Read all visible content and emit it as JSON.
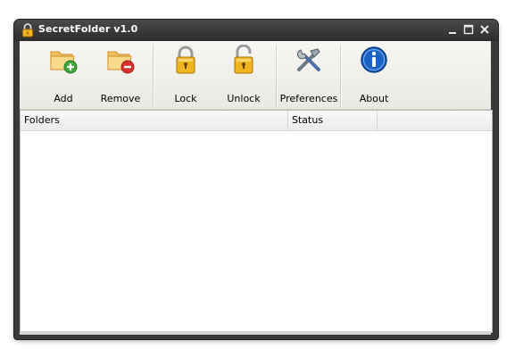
{
  "window": {
    "title": "SecretFolder v1.0"
  },
  "toolbar": {
    "add_label": "Add",
    "remove_label": "Remove",
    "lock_label": "Lock",
    "unlock_label": "Unlock",
    "preferences_label": "Preferences",
    "about_label": "About"
  },
  "list": {
    "columns": [
      "Folders",
      "Status",
      ""
    ],
    "rows": []
  },
  "colors": {
    "titlebar": "#2c2c2c",
    "toolbar": "#f0efeb",
    "folder": "#f4c45a",
    "add_badge": "#3fa83a",
    "remove_badge": "#d8322c",
    "about_badge": "#1a63c2"
  }
}
